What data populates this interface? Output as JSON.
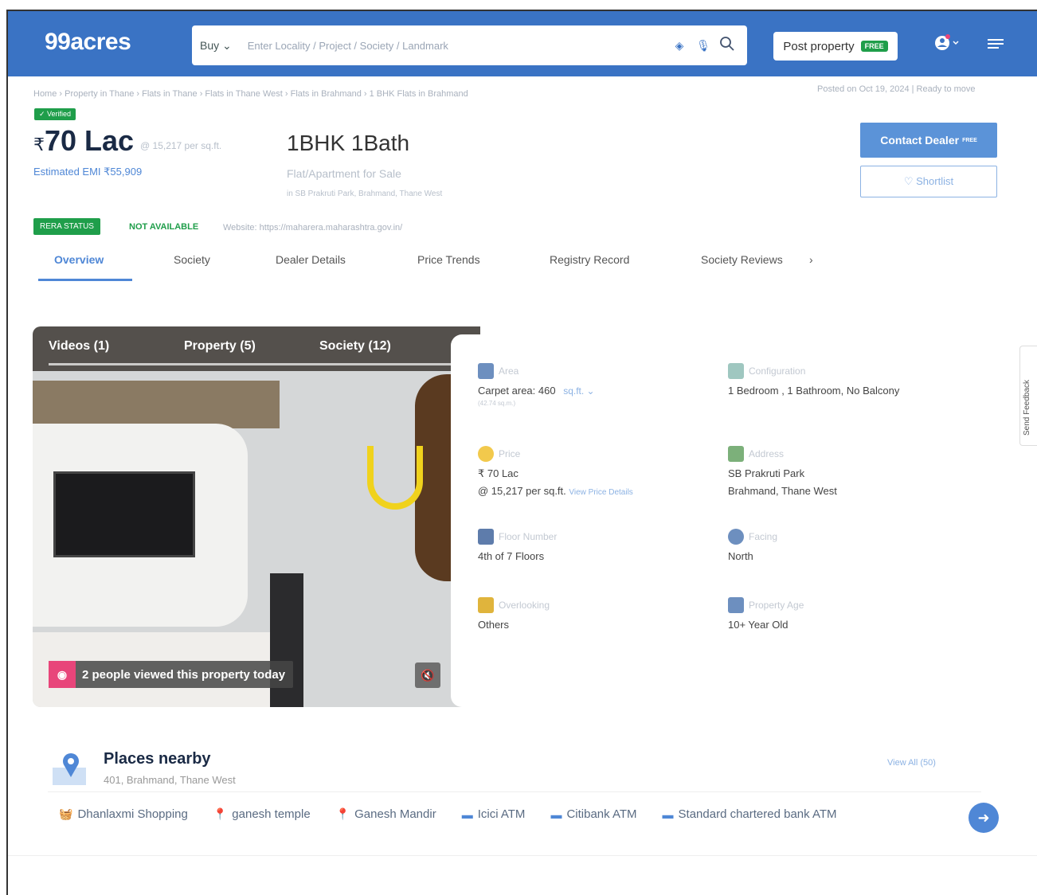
{
  "header": {
    "logo": "99acres",
    "buy_label": "Buy ⌄",
    "search_placeholder": "Enter Locality / Project / Society / Landmark",
    "post_property": "Post property",
    "free_badge": "FREE",
    "accent_color": "#3a73c4"
  },
  "breadcrumb": "Home › Property in Thane › Flats in Thane › Flats in Thane West › Flats in Brahmand › 1 BHK Flats in Brahmand",
  "posted": "Posted on Oct 19, 2024  |  Ready to move",
  "listing": {
    "verified": "✓ Verified",
    "price": "70 Lac",
    "rupee": "₹",
    "per_sqft": "@ 15,217 per sq.ft.",
    "config": "1BHK 1Bath",
    "emi": "Estimated EMI ₹55,909",
    "property_type": "Flat/Apartment for Sale",
    "address": "in SB Prakruti Park, Brahmand, Thane West",
    "contact_dealer": "Contact Dealer",
    "contact_free": "FREE",
    "shortlist": "♡  Shortlist"
  },
  "rera": {
    "status_label": "RERA STATUS",
    "status_value": "NOT AVAILABLE",
    "website": "Website: https://maharera.maharashtra.gov.in/"
  },
  "tabs": [
    "Overview",
    "Society",
    "Dealer Details",
    "Price Trends",
    "Registry Record",
    "Society Reviews"
  ],
  "gallery": {
    "tabs": [
      "Videos (1)",
      "Property (5)",
      "Society (12)"
    ],
    "views_text": "2 people viewed this property today"
  },
  "details": {
    "area": {
      "label": "Area",
      "value": "Carpet area: 460",
      "unit": "sq.ft. ⌄",
      "sub": "(42.74 sq.m.)"
    },
    "configuration": {
      "label": "Configuration",
      "value": "1 Bedroom , 1 Bathroom, No Balcony"
    },
    "price": {
      "label": "Price",
      "value1": "₹ 70 Lac",
      "value2": "@ 15,217 per sq.ft.",
      "link": "View Price Details"
    },
    "address": {
      "label": "Address",
      "value1": "SB Prakruti Park",
      "value2": "Brahmand, Thane West"
    },
    "floor": {
      "label": "Floor Number",
      "value": "4th  of 7 Floors"
    },
    "facing": {
      "label": "Facing",
      "value": "North"
    },
    "overlooking": {
      "label": "Overlooking",
      "value": "Others"
    },
    "age": {
      "label": "Property Age",
      "value": "10+ Year Old"
    }
  },
  "feedback": "Send Feedback",
  "places": {
    "title": "Places nearby",
    "subtitle": "401, Brahmand, Thane West",
    "view_all": "View All (50)",
    "chips": [
      {
        "icon": "shopping-icon",
        "label": "Dhanlaxmi Shopping"
      },
      {
        "icon": "location-pin-icon",
        "label": "ganesh temple"
      },
      {
        "icon": "location-pin-icon",
        "label": "Ganesh Mandir"
      },
      {
        "icon": "atm-icon",
        "label": "Icici ATM"
      },
      {
        "icon": "atm-icon",
        "label": "Citibank ATM"
      },
      {
        "icon": "atm-icon",
        "label": "Standard chartered bank ATM"
      }
    ]
  }
}
